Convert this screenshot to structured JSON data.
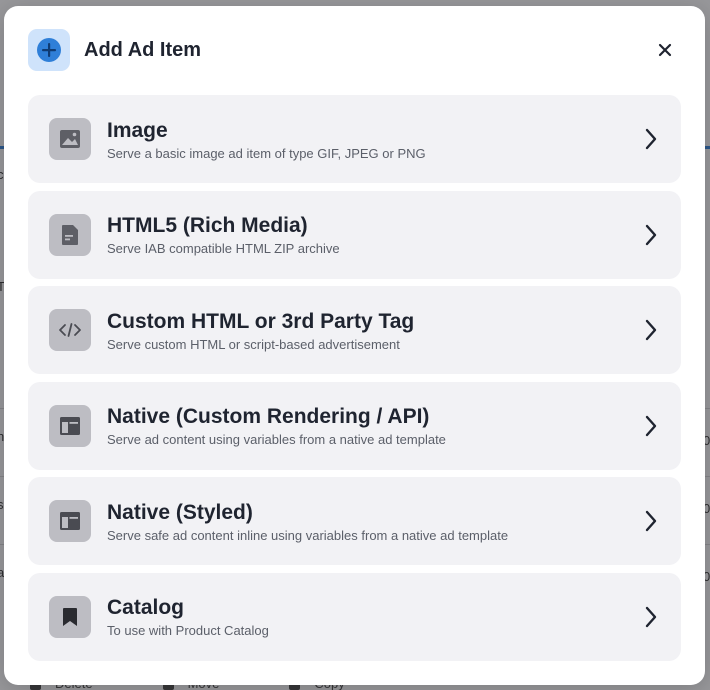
{
  "modal": {
    "title": "Add Ad Item",
    "header_icon": "plus-circle-icon",
    "close_icon": "close-icon"
  },
  "options": [
    {
      "icon": "image-icon",
      "title": "Image",
      "description": "Serve a basic image ad item of type GIF, JPEG or PNG"
    },
    {
      "icon": "document-icon",
      "title": "HTML5 (Rich Media)",
      "description": "Serve IAB compatible HTML ZIP archive"
    },
    {
      "icon": "code-icon",
      "title": "Custom HTML or 3rd Party Tag",
      "description": "Serve custom HTML or script-based advertisement"
    },
    {
      "icon": "layout-icon",
      "title": "Native (Custom Rendering / API)",
      "description": "Serve ad content using variables from a native ad template"
    },
    {
      "icon": "layout-icon",
      "title": "Native (Styled)",
      "description": "Serve safe ad content inline using variables from a native ad template"
    },
    {
      "icon": "bookmark-icon",
      "title": "Catalog",
      "description": "To use with Product Catalog"
    }
  ],
  "background": {
    "toolbar": [
      "Delete",
      "Move",
      "Copy"
    ],
    "row_fragments": [
      "c",
      "T",
      "n",
      "l",
      "s",
      "l",
      "a",
      "l",
      "0",
      "0",
      "0"
    ]
  },
  "colors": {
    "accent": "#2f7fd8",
    "header_icon_bg": "#cfe3fb",
    "option_bg": "#f2f2f5",
    "option_icon_bg": "#bdbdc3",
    "title_text": "#1f2430"
  }
}
